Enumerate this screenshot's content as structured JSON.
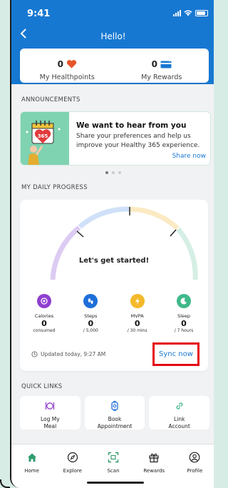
{
  "status_bar": {
    "time": "9:41"
  },
  "header": {
    "title": "Hello!"
  },
  "rewards": {
    "healthpoints": {
      "value": "0",
      "label": "My Healthpoints"
    },
    "rewards": {
      "value": "0",
      "label": "My Rewards"
    }
  },
  "announcements": {
    "section_label": "ANNOUNCEMENTS",
    "card": {
      "art_text": "365",
      "title": "We want to hear from you",
      "body": "Share your preferences and help us improve your Healthy 365 experience.",
      "link": "Share now"
    },
    "page_count": 3,
    "active_page": 1
  },
  "daily_progress": {
    "section_label": "MY DAILY PROGRESS",
    "gauge_label": "Let's get started!",
    "metrics": [
      {
        "name": "Calories",
        "value": "0",
        "unit": "consumed",
        "color": "#8f3fd0",
        "icon": "calories-icon"
      },
      {
        "name": "Steps",
        "value": "0",
        "unit": "/ 5,000",
        "color": "#1e6fd9",
        "icon": "steps-icon"
      },
      {
        "name": "MVPA",
        "value": "0",
        "unit": "/ 30 mins",
        "color": "#f4b92a",
        "icon": "lightning-icon"
      },
      {
        "name": "Sleep",
        "value": "0",
        "unit": "/ 7 hours",
        "color": "#3fb98a",
        "icon": "moon-icon"
      }
    ],
    "updated_text": "Updated today, 9:27 AM",
    "sync_label": "Sync now"
  },
  "quick_links": {
    "section_label": "QUICK LINKS",
    "items": [
      {
        "label_line1": "Log My",
        "label_line2": "Meal",
        "icon": "meal-icon"
      },
      {
        "label_line1": "Book",
        "label_line2": "Appointment",
        "icon": "appointment-icon"
      },
      {
        "label_line1": "Link",
        "label_line2": "Account",
        "icon": "link-icon"
      }
    ]
  },
  "tabbar": {
    "items": [
      {
        "label": "Home",
        "icon": "home-icon"
      },
      {
        "label": "Explore",
        "icon": "compass-icon"
      },
      {
        "label": "Scan",
        "icon": "scan-icon"
      },
      {
        "label": "Rewards",
        "icon": "gift-icon"
      },
      {
        "label": "Profile",
        "icon": "profile-icon"
      }
    ]
  },
  "colors": {
    "brand_blue": "#1778d2",
    "link_blue": "#1877d2",
    "highlight_red": "#e50914",
    "home_green": "#2f9c6c"
  }
}
